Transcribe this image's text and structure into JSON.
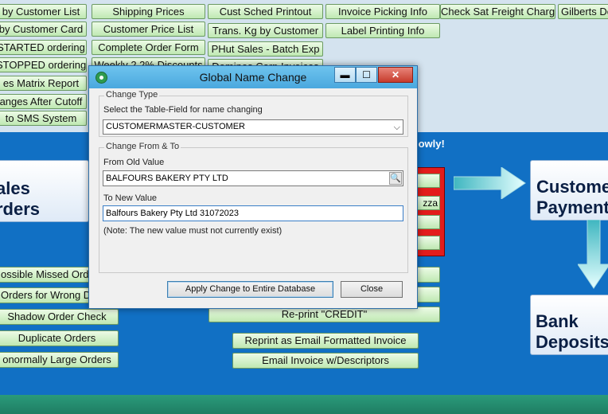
{
  "background": {
    "top_buttons": [
      {
        "id": "b1",
        "label": "by Customer List"
      },
      {
        "id": "b2",
        "label": "Shipping Prices"
      },
      {
        "id": "b3",
        "label": "Cust Sched Printout"
      },
      {
        "id": "b4",
        "label": "Invoice Picking Info"
      },
      {
        "id": "b5",
        "label": "Check Sat Freight Charge"
      },
      {
        "id": "b6",
        "label": "Gilberts De"
      },
      {
        "id": "b7",
        "label": "by Customer Card"
      },
      {
        "id": "b8",
        "label": "Customer Price List"
      },
      {
        "id": "b9",
        "label": "Trans. Kg by Customer"
      },
      {
        "id": "b10",
        "label": "Label Printing Info"
      },
      {
        "id": "b11",
        "label": "STARTED ordering"
      },
      {
        "id": "b12",
        "label": "Complete Order Form"
      },
      {
        "id": "b13",
        "label": "PHut Sales - Batch Exp"
      },
      {
        "id": "b14",
        "label": "STOPPED ordering"
      },
      {
        "id": "b15",
        "label": "Weekly 2.2% Discounts"
      },
      {
        "id": "b16",
        "label": "Dominos Corp Invoices"
      },
      {
        "id": "b17",
        "label": "es Matrix Report"
      },
      {
        "id": "b18",
        "label": "anges After Cutoff"
      },
      {
        "id": "b19",
        "label": "to SMS System"
      }
    ],
    "slowly_text": "lowly!",
    "sales_orders_label_1": "ales",
    "sales_orders_label_2": "rders",
    "customer_payments_1": "Custome",
    "customer_payments_2": "Payment",
    "bank_deposits_1": "Bank",
    "bank_deposits_2": "Deposits",
    "red_panel_item": "zza",
    "left_buttons": [
      {
        "label": "ossible Missed Ord"
      },
      {
        "label": "Orders for Wrong D"
      },
      {
        "label": "Shadow Order Check"
      },
      {
        "label": "Duplicate Orders"
      },
      {
        "label": "onormally Large Orders"
      }
    ],
    "center_buttons": [
      {
        "label": "Re-print \"CREDIT\""
      },
      {
        "label": "Reprint as Email Formatted Invoice"
      },
      {
        "label": "Email Invoice w/Descriptors"
      }
    ]
  },
  "dialog": {
    "title": "Global Name Change",
    "min_glyph": "▬",
    "max_glyph": "☐",
    "close_glyph": "✕",
    "change_type": {
      "group_label": "Change Type",
      "prompt": "Select the Table-Field for name changing",
      "selected": "CUSTOMERMASTER-CUSTOMER"
    },
    "change_from_to": {
      "group_label": "Change From & To",
      "from_label": "From Old Value",
      "from_value": "BALFOURS BAKERY PTY LTD",
      "to_label": "To New Value",
      "to_value": "Balfours Bakery Pty Ltd 31072023",
      "note": "(Note: The new value must not currently exist)"
    },
    "apply_button": "Apply Change to Entire Database",
    "close_button": "Close"
  }
}
